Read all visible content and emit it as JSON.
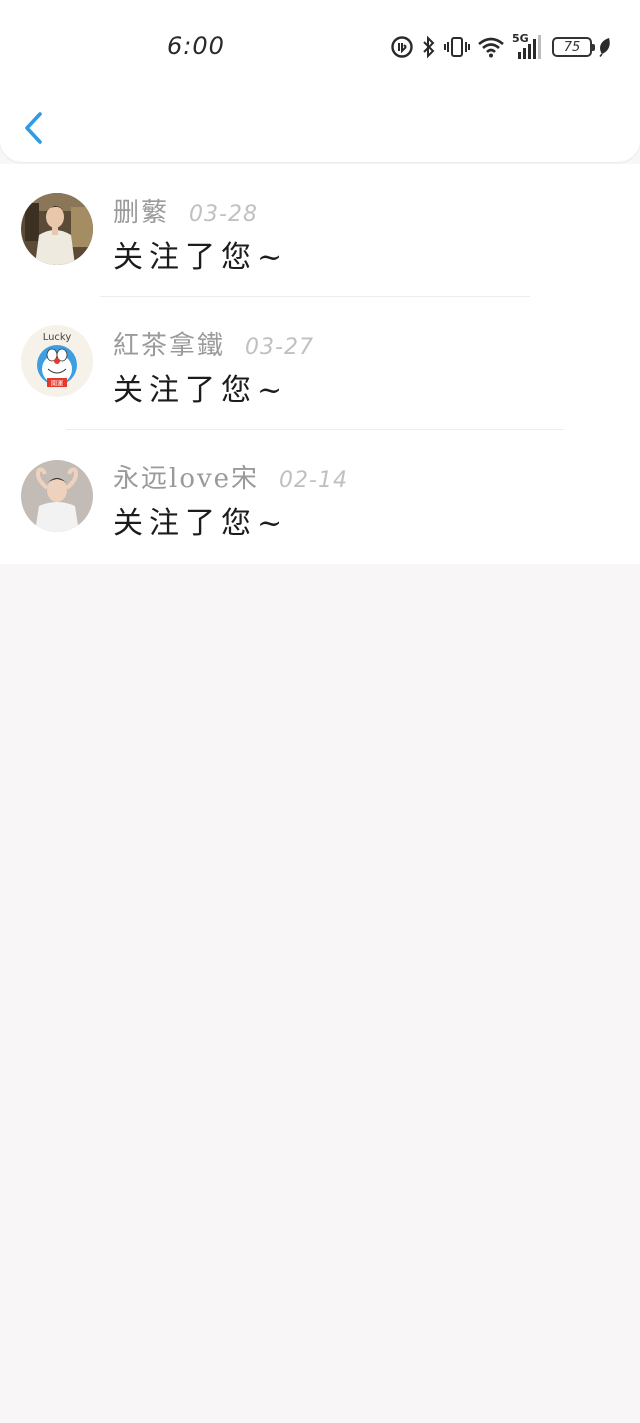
{
  "status_bar": {
    "time": "6:00",
    "network": "5G",
    "battery": "75",
    "icons": [
      "data-saver-icon",
      "bluetooth-icon",
      "vibrate-icon",
      "wifi-icon",
      "signal-icon",
      "battery-icon",
      "leaf-icon"
    ]
  },
  "header": {
    "back_icon": "chevron-left-icon",
    "accent_color": "#2f9ae6"
  },
  "notifications": [
    {
      "name": "删蘩",
      "date": "03-28",
      "message": "关注了您~"
    },
    {
      "name": "紅茶拿鐵",
      "date": "03-27",
      "message": "关注了您~"
    },
    {
      "name": "永远love宋",
      "date": "02-14",
      "message": "关注了您~"
    }
  ],
  "avatar_badge": {
    "top": "Lucky",
    "bottom": "開運"
  }
}
